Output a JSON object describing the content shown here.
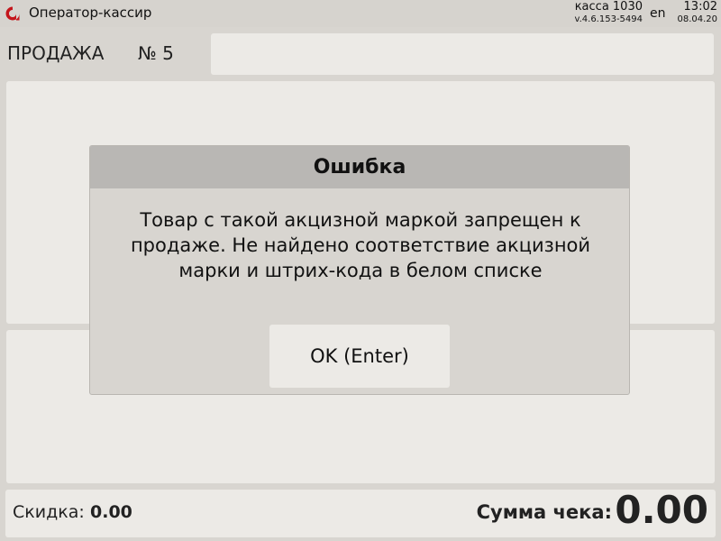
{
  "app": {
    "title": "Оператор-кассир",
    "kassa": "касса 1030",
    "version": "v.4.6.153-5494",
    "language": "en",
    "time": "13:02",
    "date": "08.04.20"
  },
  "sale": {
    "label": "ПРОДАЖА",
    "number": "№ 5",
    "input_value": ""
  },
  "footer": {
    "discount_label": "Скидка:",
    "discount_value": "0.00",
    "total_label": "Сумма чека:",
    "total_value": "0.00"
  },
  "dialog": {
    "title": "Ошибка",
    "message": "Товар с такой акцизной маркой запрещен к продаже. Не найдено соответствие акцизной марки и штрих-кода в белом списке",
    "ok_label": "OK (Enter)"
  },
  "colors": {
    "brand": "#c4161c",
    "background": "#d8d5d0",
    "panel": "#eceae6",
    "dialog_header": "#b9b7b4"
  },
  "icons": {
    "logo": "app-logo-icon"
  }
}
